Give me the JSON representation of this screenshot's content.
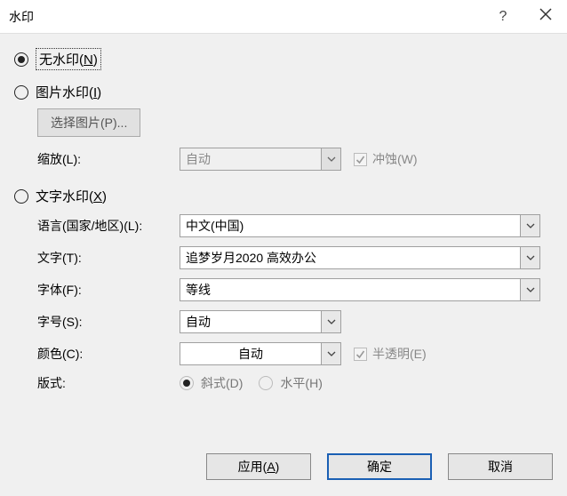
{
  "title": "水印",
  "help_symbol": "?",
  "options": {
    "no_watermark": "无水印(N)",
    "picture_watermark": "图片水印(I)",
    "text_watermark": "文字水印(X)"
  },
  "picture": {
    "select_button": "选择图片(P)...",
    "scale_label": "缩放(L):",
    "scale_value": "自动",
    "washout_label": "冲蚀(W)"
  },
  "text": {
    "language_label": "语言(国家/地区)(L):",
    "language_value": "中文(中国)",
    "text_label": "文字(T):",
    "text_value": "追梦岁月2020  高效办公",
    "font_label": "字体(F):",
    "font_value": "等线",
    "size_label": "字号(S):",
    "size_value": "自动",
    "color_label": "颜色(C):",
    "color_value": "自动",
    "semitransparent_label": "半透明(E)",
    "layout_label": "版式:",
    "layout_diagonal": "斜式(D)",
    "layout_horizontal": "水平(H)"
  },
  "buttons": {
    "apply": "应用(A)",
    "ok": "确定",
    "cancel": "取消"
  }
}
